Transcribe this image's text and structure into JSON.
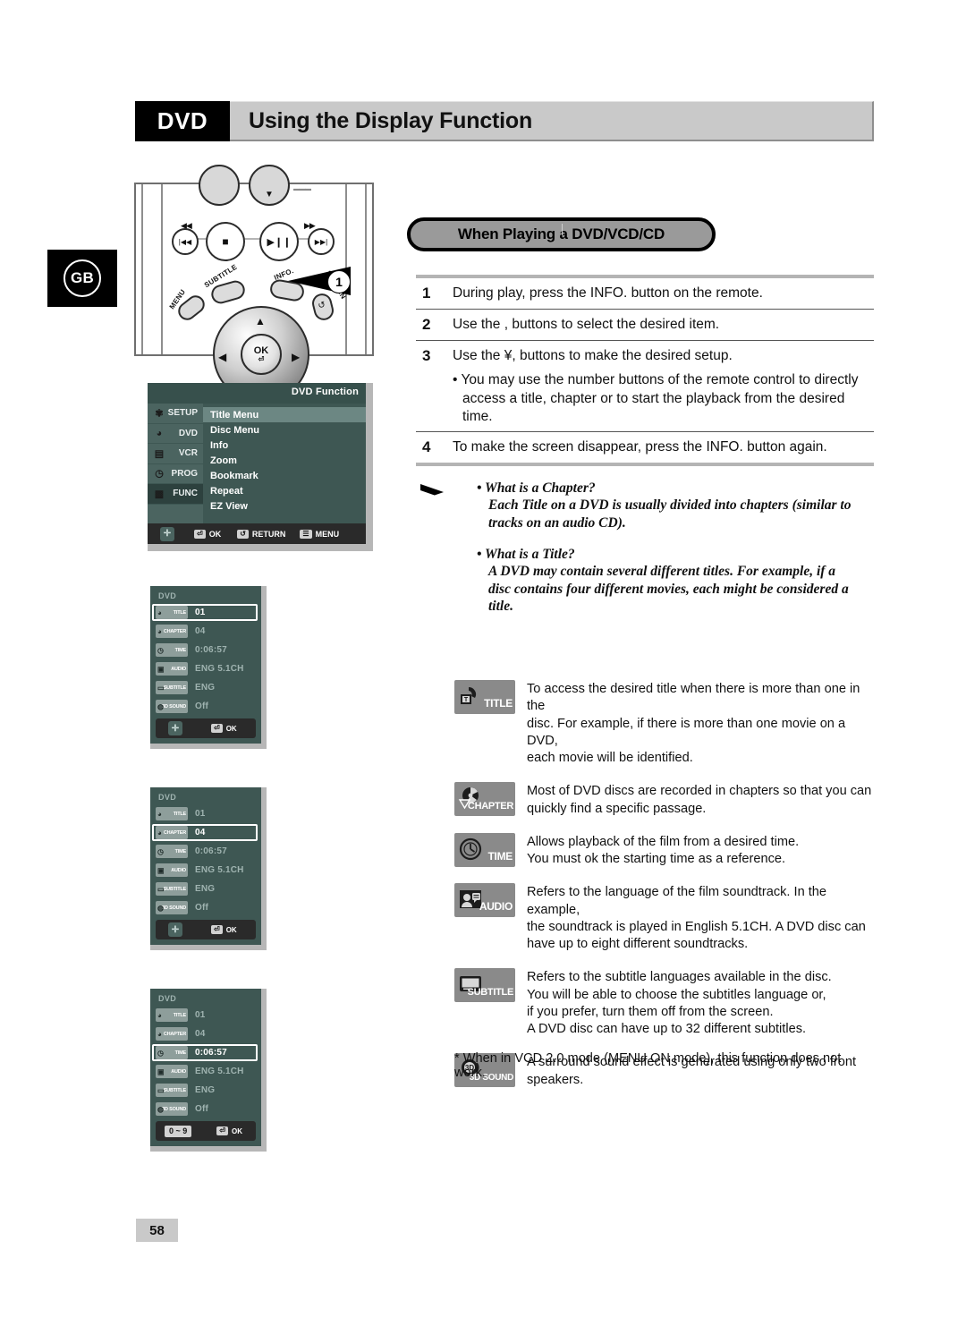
{
  "header": {
    "tag": "DVD",
    "title": "Using the Display Function"
  },
  "locale_badge": "GB",
  "page_number": "58",
  "remote": {
    "labels": {
      "menu": "MENU",
      "subtitle": "SUBTITLE",
      "info": "INFO.",
      "return": "RETURN",
      "ok": "OK",
      "rew": "◀◀",
      "ff": "▶▶",
      "prev": "|◀◀",
      "next": "▶▶|",
      "stop": "■",
      "playpause": "▶||"
    },
    "callout_number": "1"
  },
  "osd_function": {
    "title": "DVD Function",
    "sidebar": [
      {
        "label": "SETUP",
        "icon": "gear-icon"
      },
      {
        "label": "DVD",
        "icon": "dvd-disc-icon"
      },
      {
        "label": "VCR",
        "icon": "vcr-tape-icon"
      },
      {
        "label": "PROG",
        "icon": "clock-icon"
      },
      {
        "label": "FUNC",
        "icon": "function-icon"
      }
    ],
    "active_sidebar_index": 4,
    "items": [
      "Title Menu",
      "Disc Menu",
      "Info",
      "Zoom",
      "Bookmark",
      "Repeat",
      "EZ View"
    ],
    "selected_item_index": 0,
    "bottom_bar": [
      {
        "key": "navigate",
        "label": ""
      },
      {
        "key": "ok",
        "label": "OK"
      },
      {
        "key": "return",
        "label": "RETURN"
      },
      {
        "key": "menu",
        "label": "MENU"
      }
    ]
  },
  "osd_panels": [
    {
      "header": "DVD",
      "rows": [
        {
          "tag": "TITLE",
          "value": "01"
        },
        {
          "tag": "CHAPTER",
          "value": "04"
        },
        {
          "tag": "TIME",
          "value": "0:06:57"
        },
        {
          "tag": "AUDIO",
          "value": "ENG 5.1CH"
        },
        {
          "tag": "SUBTITLE",
          "value": "ENG"
        },
        {
          "tag": "3D SOUND",
          "value": "Off"
        }
      ],
      "highlighted_row": 0,
      "bottom": {
        "left": "navigate",
        "ok": "OK"
      }
    },
    {
      "header": "DVD",
      "rows": [
        {
          "tag": "TITLE",
          "value": "01"
        },
        {
          "tag": "CHAPTER",
          "value": "04"
        },
        {
          "tag": "TIME",
          "value": "0:06:57"
        },
        {
          "tag": "AUDIO",
          "value": "ENG 5.1CH"
        },
        {
          "tag": "SUBTITLE",
          "value": "ENG"
        },
        {
          "tag": "3D SOUND",
          "value": "Off"
        }
      ],
      "highlighted_row": 1,
      "bottom": {
        "left": "navigate",
        "ok": "OK"
      }
    },
    {
      "header": "DVD",
      "rows": [
        {
          "tag": "TITLE",
          "value": "01"
        },
        {
          "tag": "CHAPTER",
          "value": "04"
        },
        {
          "tag": "TIME",
          "value": "0:06:57"
        },
        {
          "tag": "AUDIO",
          "value": "ENG 5.1CH"
        },
        {
          "tag": "SUBTITLE",
          "value": "ENG"
        },
        {
          "tag": "3D SOUND",
          "value": "Off"
        }
      ],
      "highlighted_row": 2,
      "bottom": {
        "left": "0 ~ 9",
        "ok": "OK"
      }
    }
  ],
  "section": {
    "pill_title": "When Playing a DVD/VCD/CD",
    "steps": [
      {
        "num": "1",
        "text": "During play, press the INFO. button on the remote."
      },
      {
        "num": "2",
        "text": "Use the    ,     buttons to select the desired item."
      },
      {
        "num": "3",
        "text": "Use the ¥,    buttons to make the desired setup."
      },
      {
        "num": "4",
        "text": "To make the screen disappear, press the INFO. button again."
      }
    ],
    "substep": {
      "line1": "• You may use the number buttons of the remote control to directly",
      "line2": "access a title, chapter or to start the playback from the desired",
      "line3": "time."
    }
  },
  "notes": [
    {
      "heading": "• What is a Chapter?",
      "line1": "Each Title on a DVD is usually divided into chapters (similar to",
      "line2": "tracks on an audio CD).",
      "line3": ""
    },
    {
      "heading": "• What is a Title?",
      "line1": "A DVD may contain several different titles. For example, if a",
      "line2": "disc contains four different movies, each might be considered a",
      "line3": "title."
    }
  ],
  "icon_descriptions": [
    {
      "icon": "title-icon",
      "caption": "TITLE",
      "line1": "To access the desired title when there is more than one in the",
      "line2": "disc. For example, if there is more than one movie on a DVD,",
      "line3": "each movie will be identified.",
      "line4": "",
      "line5": ""
    },
    {
      "icon": "chapter-icon",
      "caption": "CHAPTER",
      "line1": "Most of DVD discs are recorded in chapters so that you can",
      "line2": "quickly find a specific passage.",
      "line3": "",
      "line4": "",
      "line5": ""
    },
    {
      "icon": "time-icon",
      "caption": "TIME",
      "line1": "Allows playback of the film from a desired time.",
      "line2": "You must ok the starting time as a reference.",
      "line3": "",
      "line4": "",
      "line5": ""
    },
    {
      "icon": "audio-icon",
      "caption": "AUDIO",
      "line1": "Refers to the language of the film soundtrack. In the example,",
      "line2": "the soundtrack is played in English 5.1CH. A DVD disc can",
      "line3": "have up to eight different soundtracks.",
      "line4": "",
      "line5": ""
    },
    {
      "icon": "subtitle-icon",
      "caption": "SUBTITLE",
      "line1": "Refers to the subtitle languages available in the disc.",
      "line2": "You will be able to choose the subtitles language or,",
      "line3": "if you prefer, turn them off from the screen.",
      "line4": "A DVD disc can have up to 32 different subtitles.",
      "line5": ""
    },
    {
      "icon": "3d-sound-icon",
      "caption": "3D SOUND",
      "line1": "A surround sound effect is generated using only two front",
      "line2": "speakers.",
      "line3": "",
      "line4": "",
      "line5": ""
    }
  ],
  "footnote": "* When in VCD 2.0 mode (MENU ON mode), this function does not work.",
  "colors": {
    "osd_bg": "#3e5753",
    "osd_sidebar": "#4b6460",
    "osd_selected": "#6c8783",
    "header_bar": "#c9c9c9",
    "icon_chip": "#8a8a8a"
  }
}
